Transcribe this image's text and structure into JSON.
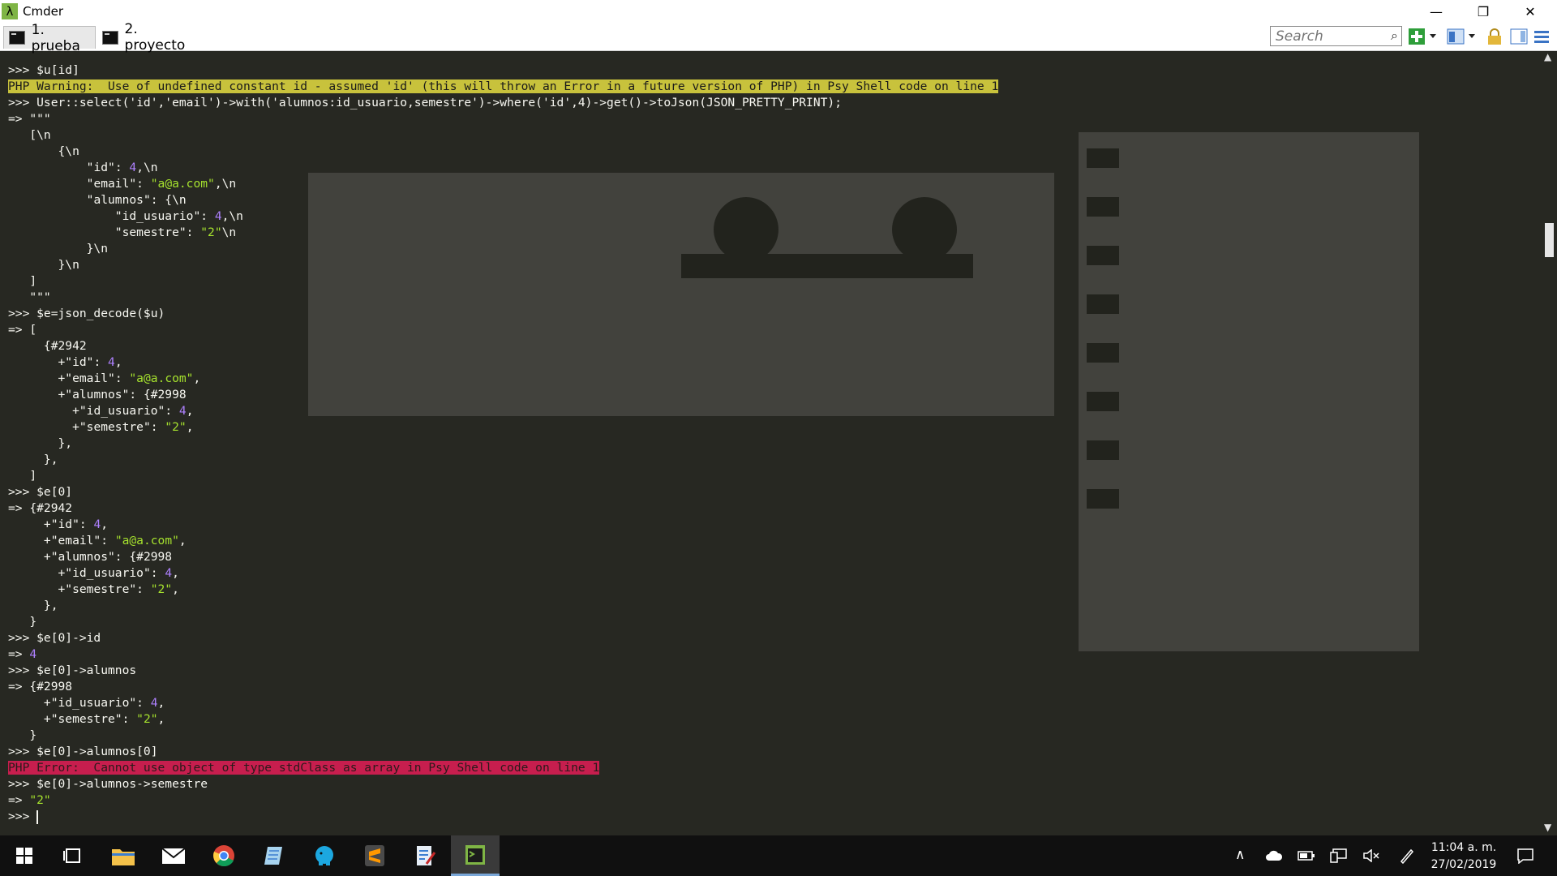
{
  "window": {
    "title": "Cmder",
    "minimize": "—",
    "restore": "❐",
    "close": "✕"
  },
  "tabs": [
    {
      "label": "1. prueba"
    },
    {
      "label": "2. proyecto"
    }
  ],
  "search": {
    "placeholder": "Search"
  },
  "terminal_lines": [
    ">>> $u[id]",
    "PHP Warning:  Use of undefined constant id - assumed 'id' (this will throw an Error in a future version of PHP) in Psy Shell code on line 1",
    ">>> User::select('id','email')->with('alumnos:id_usuario,semestre')->where('id',4)->get()->toJson(JSON_PRETTY_PRINT);",
    "=> \"\"\"",
    "   [\\n",
    "       {\\n",
    "           \"id\": 4,\\n",
    "           \"email\": \"a@a.com\",\\n",
    "           \"alumnos\": {\\n",
    "               \"id_usuario\": 4,\\n",
    "               \"semestre\": \"2\"\\n",
    "           }\\n",
    "       }\\n",
    "   ]",
    "   \"\"\"",
    ">>> $e=json_decode($u)",
    "=> [",
    "     {#2942",
    "       +\"id\": 4,",
    "       +\"email\": \"a@a.com\",",
    "       +\"alumnos\": {#2998",
    "         +\"id_usuario\": 4,",
    "         +\"semestre\": \"2\",",
    "       },",
    "     },",
    "   ]",
    ">>> $e[0]",
    "=> {#2942",
    "     +\"id\": 4,",
    "     +\"email\": \"a@a.com\",",
    "     +\"alumnos\": {#2998",
    "       +\"id_usuario\": 4,",
    "       +\"semestre\": \"2\",",
    "     },",
    "   }",
    ">>> $e[0]->id",
    "=> 4",
    ">>> $e[0]->alumnos",
    "=> {#2998",
    "     +\"id_usuario\": 4,",
    "     +\"semestre\": \"2\",",
    "   }",
    ">>> $e[0]->alumnos[0]",
    "PHP Error:  Cannot use object of type stdClass as array in Psy Shell code on line 1",
    ">>> $e[0]->alumnos->semestre",
    "=> \"2\"",
    ">>> "
  ],
  "clock": {
    "time": "11:04 a. m.",
    "date": "27/02/2019"
  },
  "colors": {
    "terminal_bg": "#272822",
    "warning_bg": "#c8c23c",
    "error_bg": "#c71e4e",
    "string": "#a6e22e",
    "number": "#ae81ff"
  }
}
